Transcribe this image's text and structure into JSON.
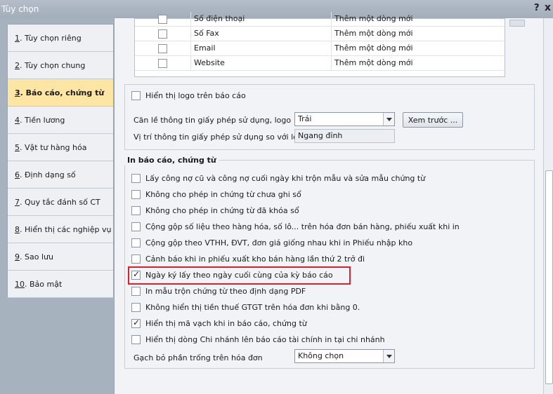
{
  "window": {
    "title": "Tùy chọn",
    "help": "?",
    "close": "x"
  },
  "sidebar": {
    "items": [
      {
        "num": "1",
        "label": "Tùy chọn riêng"
      },
      {
        "num": "2",
        "label": "Tùy chọn chung"
      },
      {
        "num": "3",
        "label": "Báo cáo, chứng từ"
      },
      {
        "num": "4",
        "label": "Tiền lương"
      },
      {
        "num": "5",
        "label": "Vật tư hàng hóa"
      },
      {
        "num": "6",
        "label": "Định dạng số"
      },
      {
        "num": "7",
        "label": "Quy tắc đánh số CT"
      },
      {
        "num": "8",
        "label": "Hiển thị các nghiệp vụ"
      },
      {
        "num": "9",
        "label": "Sao lưu"
      },
      {
        "num": "10",
        "label": "Bảo mật"
      }
    ]
  },
  "contact_grid": {
    "rows": [
      {
        "name": "Số điện thoại",
        "add": "Thêm một dòng mới"
      },
      {
        "name": "Số Fax",
        "add": "Thêm một dòng mới"
      },
      {
        "name": "Email",
        "add": "Thêm một dòng mới"
      },
      {
        "name": "Website",
        "add": "Thêm một dòng mới"
      }
    ]
  },
  "logo": {
    "show_logo_label": "Hiển thị logo trên báo cáo",
    "align_label": "Căn lề thông tin giấy phép sử dụng, logo",
    "align_value": "Trái",
    "preview_button": "Xem trước ...",
    "position_label": "Vị trí thông tin giấy phép sử dụng so với logo",
    "position_value": "Ngang đỉnh"
  },
  "print_section": {
    "title": "In báo cáo, chứng từ",
    "options": [
      {
        "label": "Lấy công nợ cũ và công nợ cuối ngày khi trộn mẫu và sửa mẫu chứng từ",
        "checked": false
      },
      {
        "label": "Không cho phép in chứng từ chưa ghi sổ",
        "checked": false
      },
      {
        "label": "Không cho phép in chứng từ đã khóa sổ",
        "checked": false
      },
      {
        "label": "Cộng gộp số liệu theo hàng hóa, số lô... trên hóa đơn bán hàng, phiếu xuất khi in",
        "checked": false
      },
      {
        "label": "Cộng gộp theo VTHH, ĐVT, đơn giá giống nhau khi in Phiếu nhập kho",
        "checked": false
      },
      {
        "label": "Cảnh báo khi in phiếu xuất kho bán hàng lần thứ 2 trở đi",
        "checked": false
      },
      {
        "label": "Ngày ký lấy theo ngày cuối cùng của kỳ báo cáo",
        "checked": true
      },
      {
        "label": "In mẫu trộn chứng từ theo định dạng PDF",
        "checked": false
      },
      {
        "label": "Không hiển thị tiền thuế GTGT trên hóa đơn khi bằng 0.",
        "checked": false
      },
      {
        "label": "Hiển thị mã vạch khi in báo cáo, chứng từ",
        "checked": true
      },
      {
        "label": "Hiển thị dòng Chi nhánh lên báo cáo tài chính in tại chi nhánh",
        "checked": false
      }
    ],
    "strike_label": "Gạch bỏ phần trống trên hóa đơn",
    "strike_value": "Không chọn"
  },
  "colors": {
    "accent_selected": "#fde6a4",
    "highlight": "#d9222a"
  }
}
